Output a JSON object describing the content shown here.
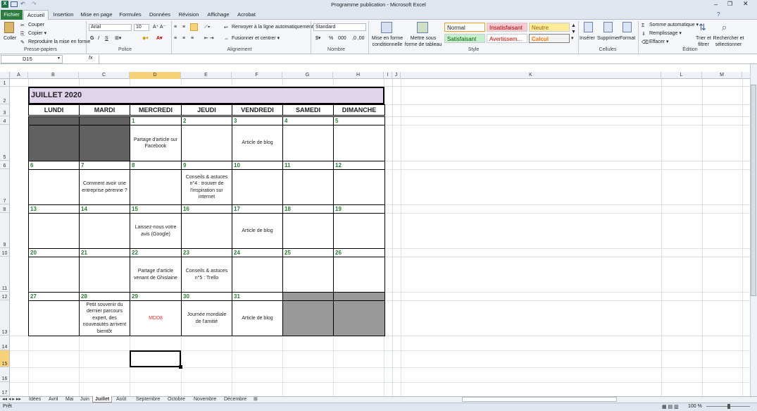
{
  "window": {
    "title": "Programme publication - Microsoft Excel"
  },
  "ribbon_tabs": [
    "Fichier",
    "Accueil",
    "Insertion",
    "Mise en page",
    "Formules",
    "Données",
    "Révision",
    "Affichage",
    "Acrobat"
  ],
  "ribbon": {
    "paste": "Coller",
    "cut": "Couper",
    "copy": "Copier",
    "format_painter": "Reproduire la mise en forme",
    "clipboard_group": "Presse-papiers",
    "font_name": "Arial",
    "font_size": "10",
    "font_group": "Police",
    "wrap": "Renvoyer à la ligne automatiquement",
    "merge": "Fusionner et centrer",
    "align_group": "Alignement",
    "number_format": "Standard",
    "number_group": "Nombre",
    "cond_format": "Mise en forme conditionnelle",
    "table_format": "Mettre sous forme de tableau",
    "style_normal": "Normal",
    "style_bad": "Insatisfaisant",
    "style_neutral": "Neutre",
    "style_good": "Satisfaisant",
    "style_warning": "Avertissem...",
    "style_calc": "Calcul",
    "style_group": "Style",
    "insert": "Insérer",
    "delete": "Supprimer",
    "format": "Format",
    "cells_group": "Cellules",
    "autosum": "Somme automatique",
    "fill": "Remplissage",
    "clear": "Effacer",
    "sort": "Trier et filtrer",
    "find": "Rechercher et sélectionner",
    "edit_group": "Édition"
  },
  "formula_bar": {
    "name_box": "D15",
    "fx": "fx",
    "formula": ""
  },
  "columns": [
    "A",
    "B",
    "C",
    "D",
    "E",
    "F",
    "G",
    "H",
    "I",
    "J",
    "K",
    "L",
    "M"
  ],
  "rows": [
    "1",
    "2",
    "3",
    "4",
    "5",
    "6",
    "7",
    "8",
    "9",
    "10",
    "11",
    "12",
    "13",
    "14",
    "15",
    "16",
    "17"
  ],
  "calendar": {
    "title": "JUILLET 2020",
    "days": [
      "LUNDI",
      "MARDI",
      "MERCREDI",
      "JEUDI",
      "VENDREDI",
      "SAMEDI",
      "DIMANCHE"
    ],
    "weeks": [
      {
        "nums": [
          "",
          "",
          "1",
          "2",
          "3",
          "4",
          "5"
        ],
        "events": [
          "",
          "",
          "Partage d'article sur Facebook",
          "",
          "Article de blog",
          "",
          ""
        ]
      },
      {
        "nums": [
          "6",
          "7",
          "8",
          "9",
          "10",
          "11",
          "12"
        ],
        "events": [
          "",
          "Comment avoir une entreprise pérenne ?",
          "",
          "Conseils & astuces n°4 : trouver de l'inspiration sur internet",
          "",
          "",
          ""
        ]
      },
      {
        "nums": [
          "13",
          "14",
          "15",
          "16",
          "17",
          "18",
          "19"
        ],
        "events": [
          "",
          "",
          "Laissez-nous votre avis (Google)",
          "",
          "Article de blog",
          "",
          ""
        ]
      },
      {
        "nums": [
          "20",
          "21",
          "22",
          "23",
          "24",
          "25",
          "26"
        ],
        "events": [
          "",
          "",
          "Partage d'article venant de Ghislaine",
          "Conseils & astuces n°5 : Trello",
          "",
          "",
          ""
        ]
      },
      {
        "nums": [
          "27",
          "28",
          "29",
          "30",
          "31",
          "",
          ""
        ],
        "events": [
          "",
          "Petit souvenir du dernier parcours expert, des nouveautés arrivent bientôt",
          "MDD8",
          "Journée mondiale de l'amitié",
          "Article de blog",
          "",
          ""
        ]
      }
    ]
  },
  "sheet_tabs": [
    "Idées",
    "Avril",
    "Mai",
    "Juin",
    "Juillet",
    "Août",
    "Septembre",
    "Octobre",
    "Novembre",
    "Décembre"
  ],
  "active_sheet": "Juillet",
  "status": {
    "ready": "Prêt",
    "zoom": "100 %"
  }
}
